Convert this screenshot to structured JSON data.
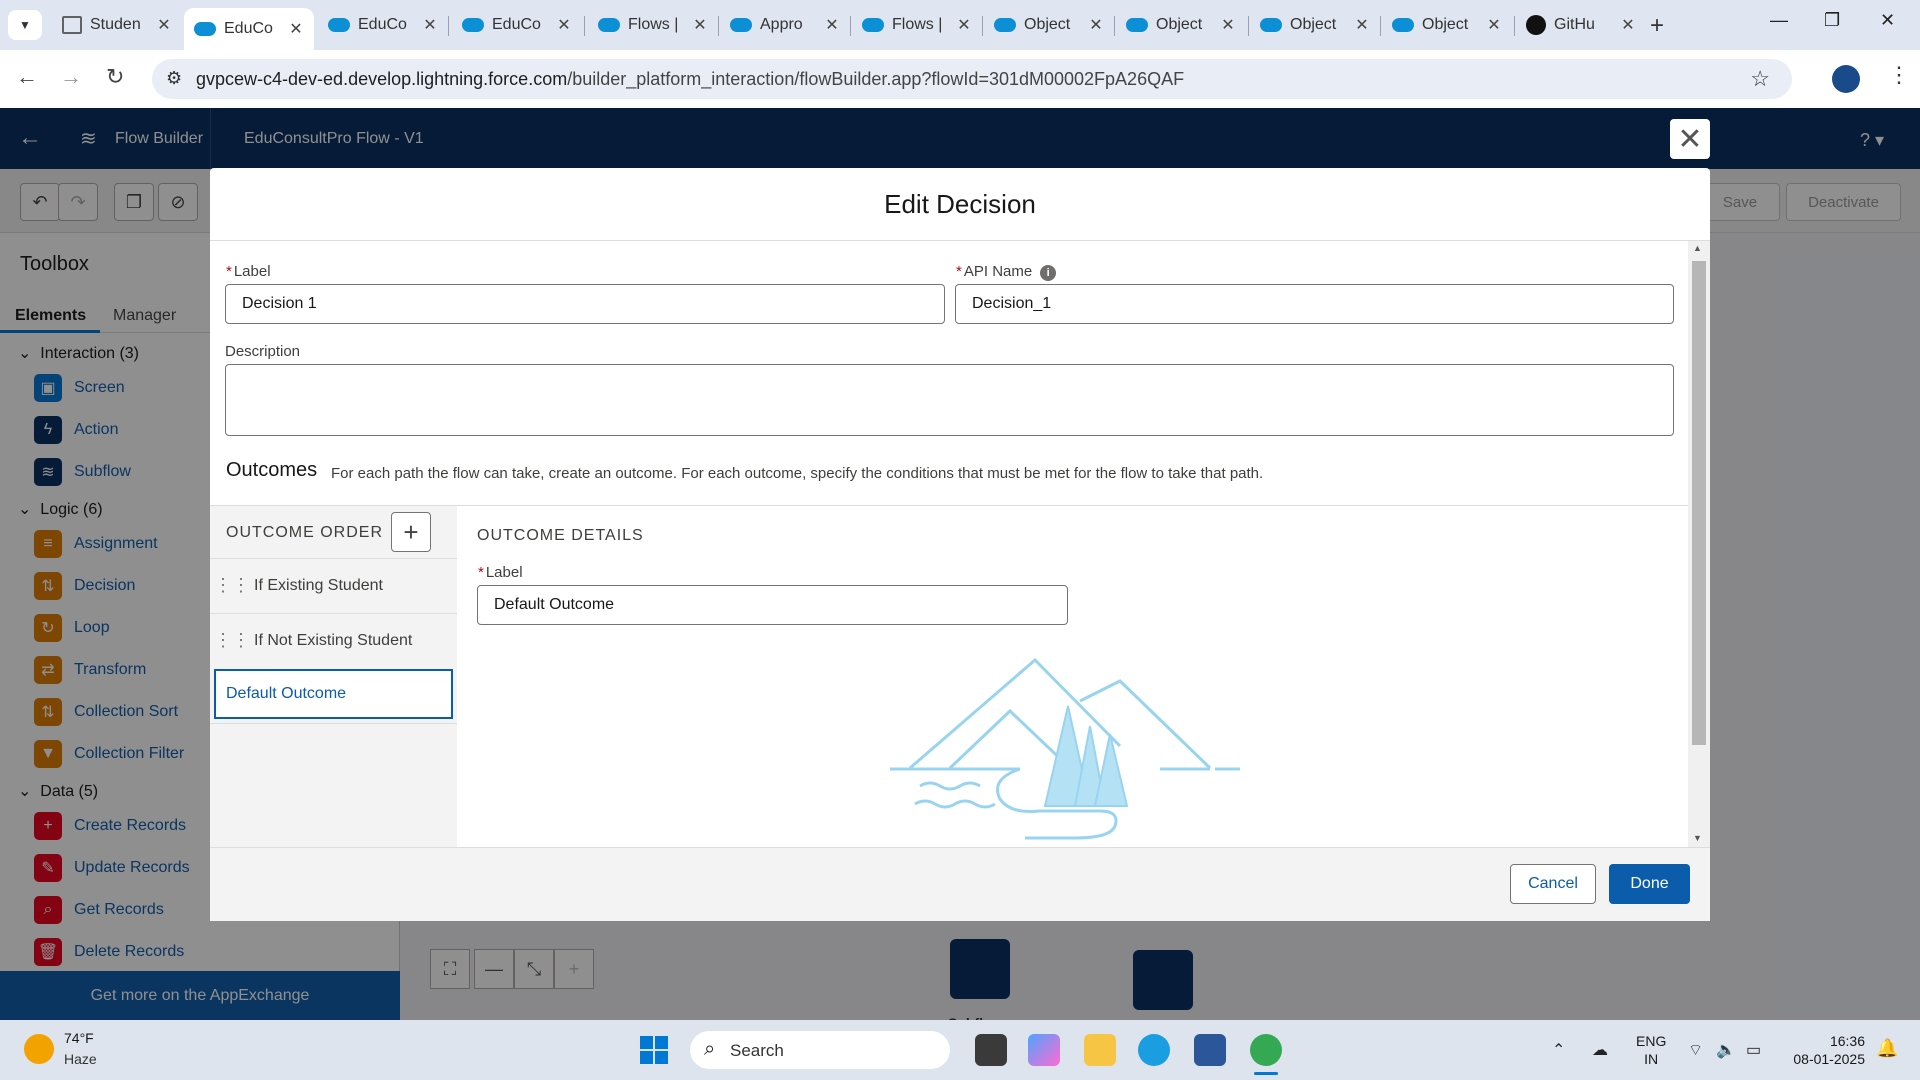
{
  "browser": {
    "tabs": [
      {
        "title": "Studen",
        "icon": "chart-icon"
      },
      {
        "title": "EduCo",
        "icon": "salesforce-icon",
        "active": true
      },
      {
        "title": "EduCo",
        "icon": "salesforce-icon"
      },
      {
        "title": "EduCo",
        "icon": "salesforce-icon"
      },
      {
        "title": "Flows |",
        "icon": "salesforce-icon"
      },
      {
        "title": "Appro",
        "icon": "salesforce-icon"
      },
      {
        "title": "Flows |",
        "icon": "salesforce-icon"
      },
      {
        "title": "Object",
        "icon": "salesforce-icon"
      },
      {
        "title": "Object",
        "icon": "salesforce-icon"
      },
      {
        "title": "Object",
        "icon": "salesforce-icon"
      },
      {
        "title": "Object",
        "icon": "salesforce-icon"
      },
      {
        "title": "GitHu",
        "icon": "github-icon"
      }
    ],
    "url_host": "gvpcew-c4-dev-ed.develop.lightning.force.com",
    "url_path": "/builder_platform_interaction/flowBuilder.app?flowId=301dM00002FpA26QAF"
  },
  "header": {
    "app_title": "Flow Builder",
    "flow_name": "EduConsultPro Flow - V1",
    "help": "?"
  },
  "toolbar": {
    "save": "Save",
    "deactivate": "Deactivate"
  },
  "toolbox": {
    "title": "Toolbox",
    "tab_elements": "Elements",
    "tab_manager": "Manager",
    "groups": [
      {
        "label": "Interaction (3)",
        "items": [
          {
            "label": "Screen",
            "color": "#0176d3"
          },
          {
            "label": "Action",
            "color": "#032d60"
          },
          {
            "label": "Subflow",
            "color": "#032d60"
          }
        ]
      },
      {
        "label": "Logic (6)",
        "items": [
          {
            "label": "Assignment",
            "color": "#dd7a01"
          },
          {
            "label": "Decision",
            "color": "#dd7a01"
          },
          {
            "label": "Loop",
            "color": "#dd7a01"
          },
          {
            "label": "Transform",
            "color": "#dd7a01"
          },
          {
            "label": "Collection Sort",
            "color": "#dd7a01"
          },
          {
            "label": "Collection Filter",
            "color": "#dd7a01"
          }
        ]
      },
      {
        "label": "Data (5)",
        "items": [
          {
            "label": "Create Records",
            "color": "#ea001e"
          },
          {
            "label": "Update Records",
            "color": "#ea001e"
          },
          {
            "label": "Get Records",
            "color": "#ea001e"
          },
          {
            "label": "Delete Records",
            "color": "#ea001e"
          }
        ]
      }
    ],
    "appexchange": "Get more on the AppExchange"
  },
  "canvas": {
    "partial_label": "Subfl"
  },
  "modal": {
    "title": "Edit Decision",
    "label_label": "Label",
    "label_value": "Decision 1",
    "api_label": "API Name",
    "api_value": "Decision_1",
    "description_label": "Description",
    "description_value": "",
    "outcomes_title": "Outcomes",
    "outcomes_desc": "For each path the flow can take, create an outcome. For each outcome, specify the conditions that must be met for the flow to take that path.",
    "outcome_order_label": "OUTCOME ORDER",
    "outcomes": [
      {
        "label": "If Existing Student"
      },
      {
        "label": "If Not Existing Student"
      },
      {
        "label": "Default Outcome",
        "selected": true
      }
    ],
    "outcome_details_label": "OUTCOME DETAILS",
    "detail_label_label": "Label",
    "detail_label_value": "Default Outcome",
    "cancel": "Cancel",
    "done": "Done"
  },
  "taskbar": {
    "weather_temp": "74°F",
    "weather_cond": "Haze",
    "search": "Search",
    "lang1": "ENG",
    "lang2": "IN",
    "time": "16:36",
    "date": "08-01-2025"
  },
  "colors": {
    "brand_navy": "#032d60",
    "brand_blue": "#0b5cab"
  }
}
